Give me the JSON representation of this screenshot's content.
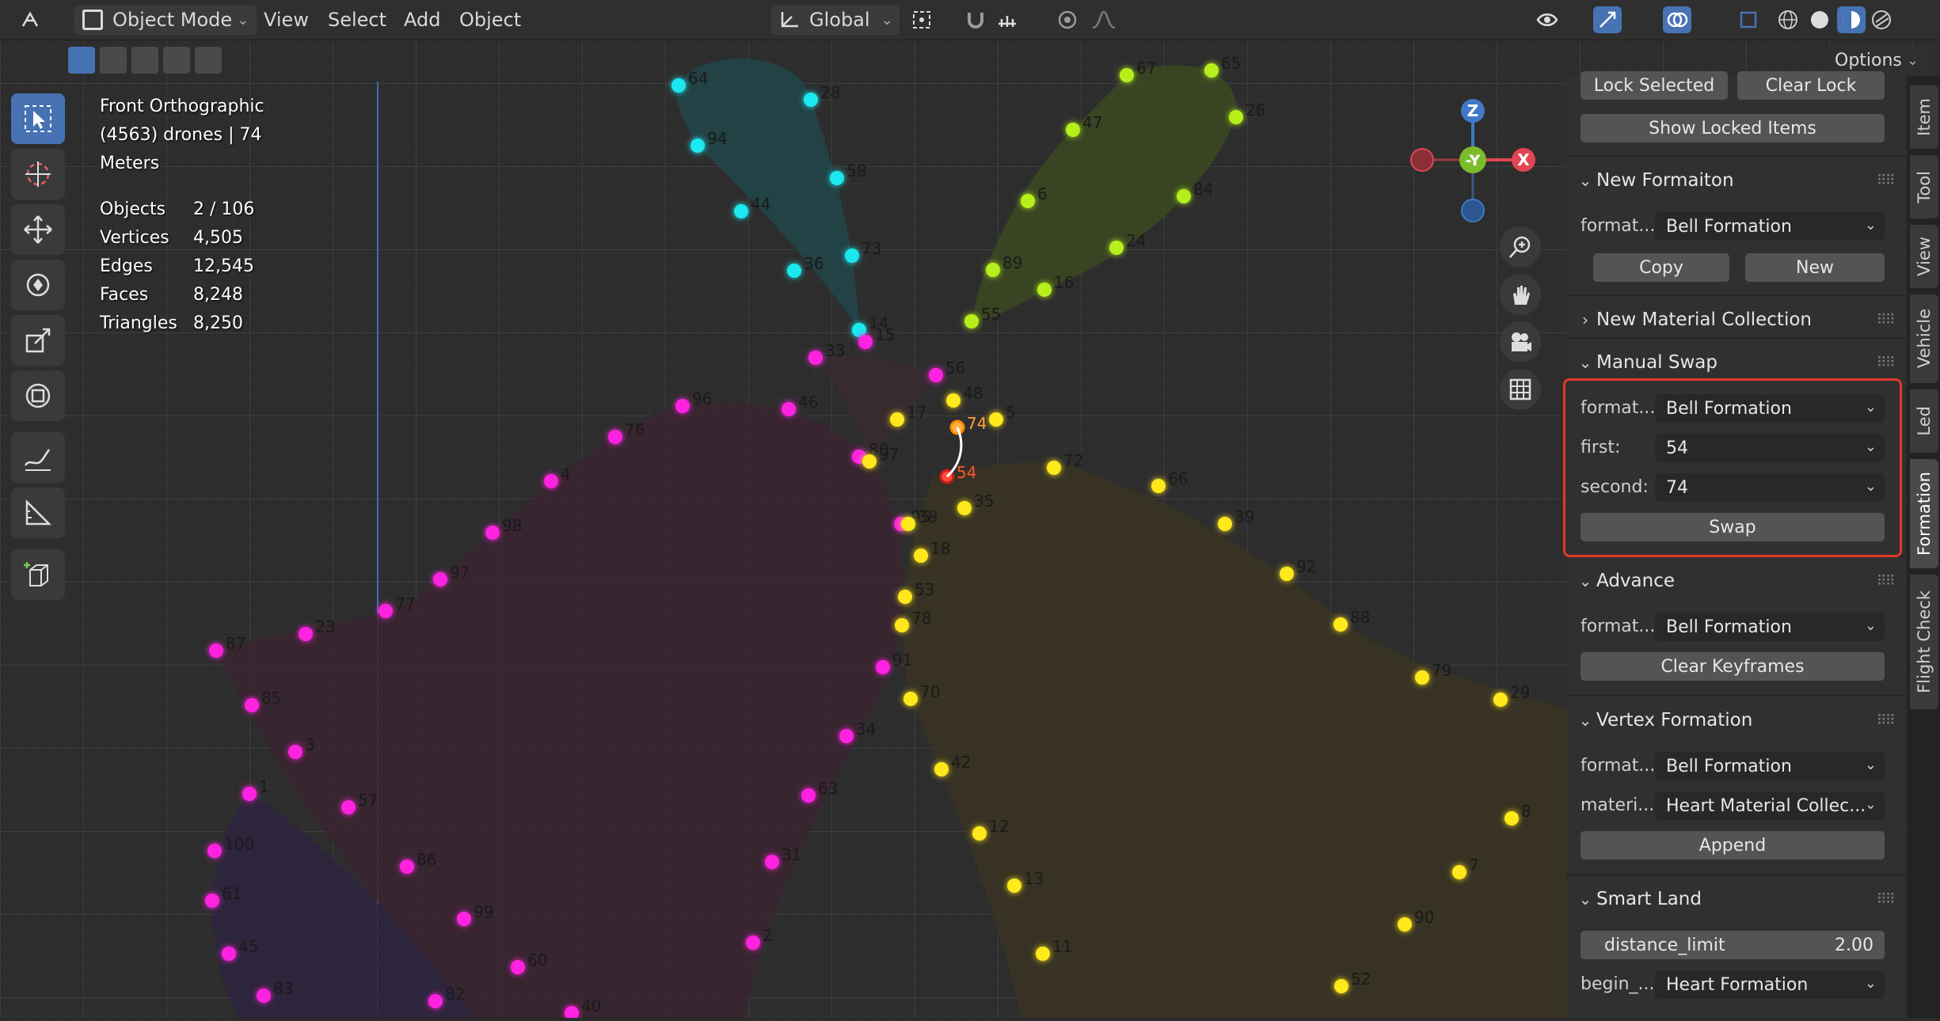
{
  "header": {
    "mode_label": "Object Mode",
    "menu": [
      "View",
      "Select",
      "Add",
      "Object"
    ],
    "transform_orientation": "Global",
    "options_label": "Options"
  },
  "viewport_info": {
    "view_name": "Front Orthographic",
    "collection_line": "(4563) drones | 74",
    "units": "Meters",
    "stats": [
      {
        "label": "Objects",
        "value": "2 / 106"
      },
      {
        "label": "Vertices",
        "value": "4,505"
      },
      {
        "label": "Edges",
        "value": "12,545"
      },
      {
        "label": "Faces",
        "value": "8,248"
      },
      {
        "label": "Triangles",
        "value": "8,250"
      }
    ]
  },
  "gizmo": {
    "z": "Z",
    "neg_y": "-Y",
    "x": "X"
  },
  "drones": {
    "cyan": [
      [
        "64",
        857,
        108
      ],
      [
        "28",
        1024,
        126
      ],
      [
        "94",
        881,
        184
      ],
      [
        "58",
        1057,
        225
      ],
      [
        "44",
        936,
        267
      ],
      [
        "73",
        1076,
        323
      ],
      [
        "36",
        1003,
        342
      ],
      [
        "14",
        1085,
        417
      ]
    ],
    "green": [
      [
        "67",
        1423,
        95
      ],
      [
        "65",
        1530,
        89
      ],
      [
        "47",
        1355,
        164
      ],
      [
        "26",
        1561,
        148
      ],
      [
        "6",
        1298,
        254
      ],
      [
        "84",
        1495,
        248
      ],
      [
        "24",
        1410,
        313
      ],
      [
        "89",
        1254,
        341
      ],
      [
        "16",
        1319,
        366
      ],
      [
        "55",
        1227,
        406
      ]
    ],
    "magenta": [
      [
        "15",
        1093,
        432
      ],
      [
        "33",
        1030,
        452
      ],
      [
        "56",
        1182,
        474
      ],
      [
        "96",
        862,
        513
      ],
      [
        "46",
        996,
        517
      ],
      [
        "76",
        777,
        552
      ],
      [
        "80",
        1085,
        577
      ],
      [
        "4",
        696,
        608
      ],
      [
        "98",
        622,
        673
      ],
      [
        "97",
        556,
        732
      ],
      [
        "77",
        487,
        772
      ],
      [
        "23",
        386,
        801
      ],
      [
        "87",
        273,
        822
      ],
      [
        "85",
        318,
        891
      ],
      [
        "3",
        373,
        950
      ],
      [
        "57",
        440,
        1020
      ],
      [
        "1",
        315,
        1003
      ],
      [
        "95",
        1138,
        662
      ],
      [
        "91",
        1115,
        843
      ],
      [
        "34",
        1069,
        930
      ],
      [
        "63",
        1021,
        1005
      ],
      [
        "86",
        514,
        1095
      ],
      [
        "99",
        586,
        1161
      ],
      [
        "31",
        975,
        1089
      ],
      [
        "100",
        271,
        1075
      ],
      [
        "61",
        268,
        1138
      ],
      [
        "45",
        289,
        1205
      ],
      [
        "60",
        654,
        1222
      ],
      [
        "2",
        951,
        1191
      ],
      [
        "83",
        333,
        1258
      ],
      [
        "82",
        550,
        1265
      ],
      [
        "40",
        722,
        1280
      ]
    ],
    "yellow": [
      [
        "48",
        1204,
        506
      ],
      [
        "17",
        1133,
        530
      ],
      [
        "5",
        1258,
        530
      ],
      [
        "97",
        1098,
        583
      ],
      [
        "72",
        1331,
        591
      ],
      [
        "66",
        1463,
        614
      ],
      [
        "35",
        1218,
        642
      ],
      [
        "39",
        1547,
        662
      ],
      [
        "38",
        1147,
        662
      ],
      [
        "18",
        1163,
        702
      ],
      [
        "92",
        1625,
        725
      ],
      [
        "53",
        1143,
        754
      ],
      [
        "78",
        1139,
        790
      ],
      [
        "88",
        1693,
        789
      ],
      [
        "79",
        1796,
        856
      ],
      [
        "70",
        1150,
        883
      ],
      [
        "29",
        1895,
        884
      ],
      [
        "42",
        1189,
        972
      ],
      [
        "8",
        1909,
        1034
      ],
      [
        "12",
        1237,
        1053
      ],
      [
        "7",
        1843,
        1102
      ],
      [
        "13",
        1281,
        1119
      ],
      [
        "90",
        1774,
        1168
      ],
      [
        "11",
        1317,
        1205
      ],
      [
        "52",
        1694,
        1246
      ]
    ],
    "selected": [
      [
        "74",
        1209,
        540
      ],
      [
        "54",
        1196,
        602
      ]
    ]
  },
  "sidebar": {
    "lock_selected": "Lock Selected",
    "clear_lock": "Clear Lock",
    "show_locked": "Show Locked Items",
    "new_formation": {
      "title": "New Formaiton",
      "label": "format...",
      "value": "Bell Formation",
      "copy": "Copy",
      "new": "New"
    },
    "new_material": {
      "title": "New Material Collection"
    },
    "manual_swap": {
      "title": "Manual Swap",
      "formation_label": "format...",
      "formation_value": "Bell Formation",
      "first_label": "first:",
      "first_value": "54",
      "second_label": "second:",
      "second_value": "74",
      "swap": "Swap"
    },
    "advance": {
      "title": "Advance",
      "label": "format...",
      "value": "Bell Formation",
      "clear": "Clear Keyframes"
    },
    "vertex_formation": {
      "title": "Vertex Formation",
      "label": "format...",
      "value": "Bell Formation",
      "material_label": "materi...",
      "material_value": "Heart Material Collec...",
      "append": "Append"
    },
    "smart_land": {
      "title": "Smart Land",
      "distance_label": "distance_limit",
      "distance_value": "2.00",
      "begin_label": "begin_...",
      "begin_value": "Heart Formation"
    }
  },
  "tabs": [
    "Item",
    "Tool",
    "View",
    "Vehicle",
    "Led",
    "Formation",
    "Flight Check"
  ]
}
